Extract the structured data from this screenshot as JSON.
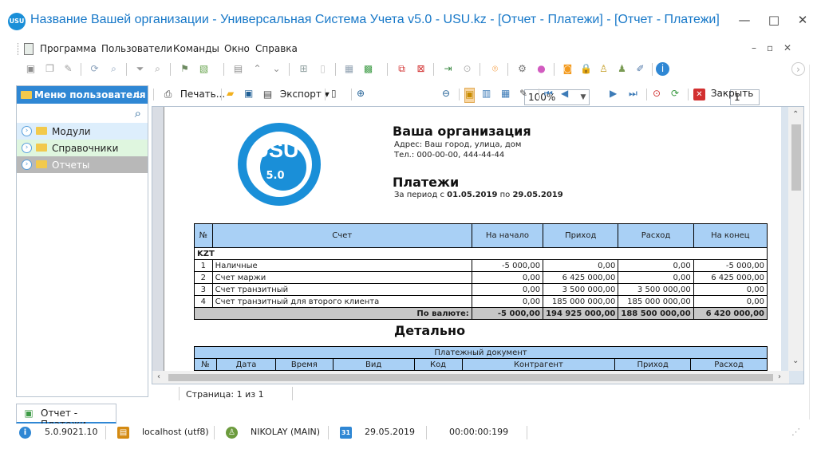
{
  "window": {
    "title": "Название Вашей организации - Универсальная Система Учета v5.0 - USU.kz - [Отчет - Платежи] - [Отчет - Платежи]",
    "controls": {
      "minimize": "—",
      "maximize": "□",
      "close": "✕"
    }
  },
  "menu": {
    "items": [
      "Программа",
      "Пользователи",
      "Команды",
      "Окно",
      "Справка"
    ],
    "mdi_controls": [
      "–",
      "▫",
      "✕"
    ]
  },
  "toolbar": {
    "icons": [
      "reports-icon",
      "copy-icon",
      "edit-icon",
      "refresh-icon",
      "search-icon",
      "filter-icon",
      "find-icon",
      "flag-icon",
      "image-icon",
      "list-icon",
      "collapse-icon",
      "expand-icon",
      "new-row-icon",
      "document-icon",
      "table-icon",
      "excel-icon",
      "new-window-icon",
      "close-window-icon",
      "exit-icon",
      "back-icon",
      "pin-icon",
      "settings-icon",
      "palette-icon",
      "rss-icon",
      "lock-icon",
      "user-icon",
      "users-icon",
      "tools-icon",
      "info-icon"
    ],
    "accent": "#1a8fd8"
  },
  "sidebar": {
    "title": "Меню пользователя",
    "items": [
      {
        "label": "Модули",
        "background": "#ddeefc"
      },
      {
        "label": "Справочники",
        "background": "#dff6df"
      },
      {
        "label": "Отчеты",
        "background": "#b8b8b8"
      }
    ]
  },
  "report_toolbar": {
    "print_label": "Печать...",
    "export_label": "Экспорт",
    "zoom_value": "100%",
    "page_number": "1",
    "close_label": "Закрыть"
  },
  "report": {
    "logo_text": "USU",
    "logo_version": "5.0",
    "organization": "Ваша организация",
    "address": "Адрес: Ваш город, улица, дом",
    "phone": "Тел.: 000-00-00, 444-44-44",
    "title": "Платежи",
    "period_prefix": "За период с",
    "period_start": "01.05.2019",
    "period_word": "по",
    "period_end": "29.05.2019",
    "summary_headers": [
      "№",
      "Счет",
      "На начало",
      "Приход",
      "Расход",
      "На конец"
    ],
    "currency": "KZT",
    "summary_rows": [
      [
        "1",
        "Наличные",
        "-5 000,00",
        "0,00",
        "0,00",
        "-5 000,00"
      ],
      [
        "2",
        "Счет маржи",
        "0,00",
        "6 425 000,00",
        "0,00",
        "6 425 000,00"
      ],
      [
        "3",
        "Счет транзитный",
        "0,00",
        "3 500 000,00",
        "3 500 000,00",
        "0,00"
      ],
      [
        "4",
        "Счет транзитный для второго клиента",
        "0,00",
        "185 000 000,00",
        "185 000 000,00",
        "0,00"
      ]
    ],
    "summary_total": [
      "По валюте:",
      "-5 000,00",
      "194 925 000,00",
      "188 500 000,00",
      "6 420 000,00"
    ],
    "detail_title": "Детально",
    "detail_group_header": "Платежный документ",
    "detail_headers": [
      "№",
      "Дата",
      "Время",
      "Вид",
      "Код",
      "Контрагент",
      "Приход",
      "Расход"
    ]
  },
  "page_status": "Страница: 1 из 1",
  "tab": {
    "label": "Отчет - Платежи"
  },
  "status": {
    "version": "5.0.9021.10",
    "server": "localhost (utf8)",
    "user": "NIKOLAY (MAIN)",
    "date": "29.05.2019",
    "time": "00:00:00:199"
  }
}
